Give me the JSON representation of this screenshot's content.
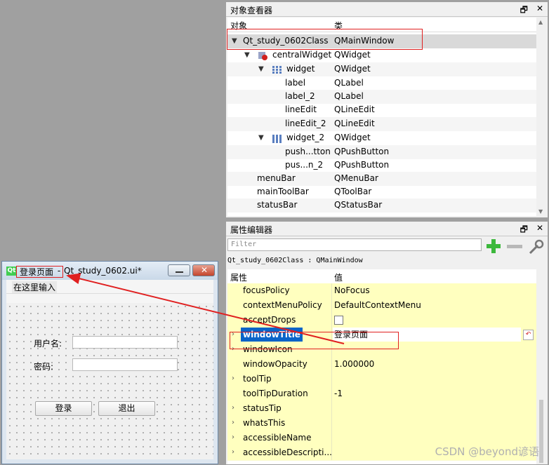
{
  "object_inspector": {
    "title": "对象查看器",
    "float_btn": "🗗",
    "close_btn": "✕",
    "col_object": "对象",
    "col_class": "类",
    "rows": [
      {
        "name": "Qt_study_0602Class",
        "cls": "QMainWindow"
      },
      {
        "name": "centralWidget",
        "cls": "QWidget"
      },
      {
        "name": "widget",
        "cls": "QWidget"
      },
      {
        "name": "label",
        "cls": "QLabel"
      },
      {
        "name": "label_2",
        "cls": "QLabel"
      },
      {
        "name": "lineEdit",
        "cls": "QLineEdit"
      },
      {
        "name": "lineEdit_2",
        "cls": "QLineEdit"
      },
      {
        "name": "widget_2",
        "cls": "QWidget"
      },
      {
        "name": "push...tton",
        "cls": "QPushButton"
      },
      {
        "name": "pus...n_2",
        "cls": "QPushButton"
      },
      {
        "name": "menuBar",
        "cls": "QMenuBar"
      },
      {
        "name": "mainToolBar",
        "cls": "QToolBar"
      },
      {
        "name": "statusBar",
        "cls": "QStatusBar"
      }
    ]
  },
  "property_editor": {
    "title": "属性编辑器",
    "float_btn": "🗗",
    "close_btn": "✕",
    "filter_placeholder": "Filter",
    "add_icon": "plus-icon",
    "object_line": "Qt_study_0602Class : QMainWindow",
    "col_property": "属性",
    "col_value": "值",
    "rows": [
      {
        "name": "focusPolicy",
        "value": "NoFocus"
      },
      {
        "name": "contextMenuPolicy",
        "value": "DefaultContextMenu"
      },
      {
        "name": "acceptDrops",
        "value": ""
      },
      {
        "name": "windowTitle",
        "value": "登录页面"
      },
      {
        "name": "windowIcon",
        "value": ""
      },
      {
        "name": "windowOpacity",
        "value": "1.000000"
      },
      {
        "name": "toolTip",
        "value": ""
      },
      {
        "name": "toolTipDuration",
        "value": "-1"
      },
      {
        "name": "statusTip",
        "value": ""
      },
      {
        "name": "whatsThis",
        "value": ""
      },
      {
        "name": "accessibleName",
        "value": ""
      },
      {
        "name": "accessibleDescripti...",
        "value": ""
      }
    ],
    "reset_icon": "reset-icon"
  },
  "form_window": {
    "title_main": "登录页面",
    "title_sep": " - ",
    "title_file": "Qt_study_0602.ui*",
    "menu_placeholder": "在这里输入",
    "username_label": "用户名:",
    "password_label": "密码:",
    "login_button": "登录",
    "exit_button": "退出"
  },
  "watermark": "CSDN @beyond谚语",
  "colors": {
    "accent_red": "#e02020",
    "selection_blue": "#0a64c8",
    "property_yellow": "#ffffbf"
  }
}
